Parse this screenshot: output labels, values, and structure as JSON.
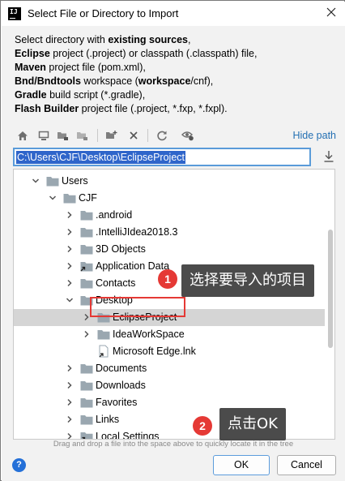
{
  "window": {
    "title": "Select File or Directory to Import",
    "app_icon_text": "IJ",
    "close_icon": "close-icon"
  },
  "description": [
    [
      {
        "t": "Select directory with "
      },
      {
        "t": "existing sources",
        "b": true
      },
      {
        "t": ","
      }
    ],
    [
      {
        "t": "Eclipse",
        "b": true
      },
      {
        "t": " project (.project) or classpath (.classpath) file,"
      }
    ],
    [
      {
        "t": "Maven",
        "b": true
      },
      {
        "t": " project file (pom.xml),"
      }
    ],
    [
      {
        "t": "Bnd/Bndtools",
        "b": true
      },
      {
        "t": " workspace ("
      },
      {
        "t": "workspace",
        "b": true
      },
      {
        "t": "/cnf),"
      }
    ],
    [
      {
        "t": "Gradle",
        "b": true
      },
      {
        "t": " build script (*.gradle),"
      }
    ],
    [
      {
        "t": "Flash Builder",
        "b": true
      },
      {
        "t": " project file (.project, *.fxp, *.fxpl)."
      }
    ]
  ],
  "toolbar": {
    "icons": [
      "home-icon",
      "desktop-icon",
      "project-icon",
      "module-icon",
      "new-folder-icon",
      "delete-icon",
      "refresh-icon",
      "show-hidden-icon"
    ],
    "hide_path_label": "Hide path"
  },
  "path": {
    "value": "C:\\Users\\CJF\\Desktop\\EclipseProject"
  },
  "tree": {
    "rows": [
      {
        "label": "Users",
        "depth": 0,
        "expanded": true,
        "type": "folder"
      },
      {
        "label": "CJF",
        "depth": 1,
        "expanded": true,
        "type": "folder"
      },
      {
        "label": ".android",
        "depth": 2,
        "expanded": false,
        "type": "folder"
      },
      {
        "label": ".IntelliJIdea2018.3",
        "depth": 2,
        "expanded": false,
        "type": "folder"
      },
      {
        "label": "3D Objects",
        "depth": 2,
        "expanded": false,
        "type": "folder"
      },
      {
        "label": "Application Data",
        "depth": 2,
        "expanded": false,
        "type": "folder-link"
      },
      {
        "label": "Contacts",
        "depth": 2,
        "expanded": false,
        "type": "folder"
      },
      {
        "label": "Desktop",
        "depth": 2,
        "expanded": true,
        "type": "folder"
      },
      {
        "label": "EclipseProject",
        "depth": 3,
        "expanded": false,
        "type": "folder",
        "selected": true
      },
      {
        "label": "IdeaWorkSpace",
        "depth": 3,
        "expanded": false,
        "type": "folder"
      },
      {
        "label": "Microsoft Edge.lnk",
        "depth": 3,
        "expanded": null,
        "type": "file"
      },
      {
        "label": "Documents",
        "depth": 2,
        "expanded": false,
        "type": "folder"
      },
      {
        "label": "Downloads",
        "depth": 2,
        "expanded": false,
        "type": "folder"
      },
      {
        "label": "Favorites",
        "depth": 2,
        "expanded": false,
        "type": "folder"
      },
      {
        "label": "Links",
        "depth": 2,
        "expanded": false,
        "type": "folder"
      },
      {
        "label": "Local Settings",
        "depth": 2,
        "expanded": false,
        "type": "folder-link"
      }
    ]
  },
  "hint": "Drag and drop a file into the space above to quickly locate it in the tree",
  "buttons": {
    "help": "?",
    "ok": "OK",
    "cancel": "Cancel"
  },
  "annotations": {
    "step1_num": "1",
    "step1_text": "选择要导入的项目",
    "step2_num": "2",
    "step2_text": "点击OK"
  },
  "colors": {
    "accent": "#2470b3",
    "selection": "#2f65ca",
    "annotation_red": "#e53935",
    "folder": "#9aa7b0"
  }
}
